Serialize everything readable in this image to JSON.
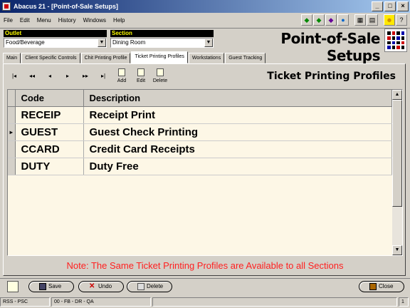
{
  "window": {
    "title": "Abacus 21 - [Point-of-Sale Setups]",
    "min": "_",
    "max": "□",
    "close": "×"
  },
  "menu": [
    "File",
    "Edit",
    "Menu",
    "History",
    "Windows",
    "Help"
  ],
  "toolbar_icons": [
    "arrow-left-icon",
    "arrow-right-icon",
    "shape-icon",
    "globe-icon",
    "calculator-icon",
    "grid-icon",
    "run-icon",
    "help-icon"
  ],
  "outlet": {
    "label": "Outlet",
    "value": "Food/Beverage"
  },
  "section": {
    "label": "Section",
    "value": "Dining Room"
  },
  "page_title": "Point-of-Sale Setups",
  "tabs": [
    {
      "label": "Main",
      "active": false
    },
    {
      "label": "Client Specific Controls",
      "active": false
    },
    {
      "label": "Chit Printing Profile",
      "active": false
    },
    {
      "label": "Ticket Printing Profiles",
      "active": true
    },
    {
      "label": "Workstations",
      "active": false
    },
    {
      "label": "Guest Tracking",
      "active": false
    }
  ],
  "nav": {
    "first": "|◂",
    "prev_page": "◂◂",
    "prev": "◂",
    "next": "▸",
    "next_page": "▸▸",
    "last": "▸|",
    "add": "Add",
    "edit": "Edit",
    "delete": "Delete"
  },
  "section_title": "Ticket Printing Profiles",
  "grid": {
    "headers": {
      "code": "Code",
      "description": "Description"
    },
    "rows": [
      {
        "code": "RECEIP",
        "description": "Receipt Print",
        "current": false
      },
      {
        "code": "GUEST",
        "description": "Guest Check Printing",
        "current": true
      },
      {
        "code": "CCARD",
        "description": "Credit Card Receipts",
        "current": false
      },
      {
        "code": "DUTY",
        "description": "Duty Free",
        "current": false
      }
    ],
    "row_marker": "▸"
  },
  "note": "Note: The Same Ticket Printing Profiles are Available to all Sections",
  "buttons": {
    "save": "Save",
    "undo": "Undo",
    "delete": "Delete",
    "close": "Close"
  },
  "status": {
    "left": "RSS - PSC",
    "mid": "00 - FB - DR - QA",
    "right": "1"
  },
  "colors": {
    "note": "#ff2020",
    "grid_bg": "#fdf7e6",
    "title_bar": "#0a246a",
    "label_fg": "#ffff00"
  }
}
